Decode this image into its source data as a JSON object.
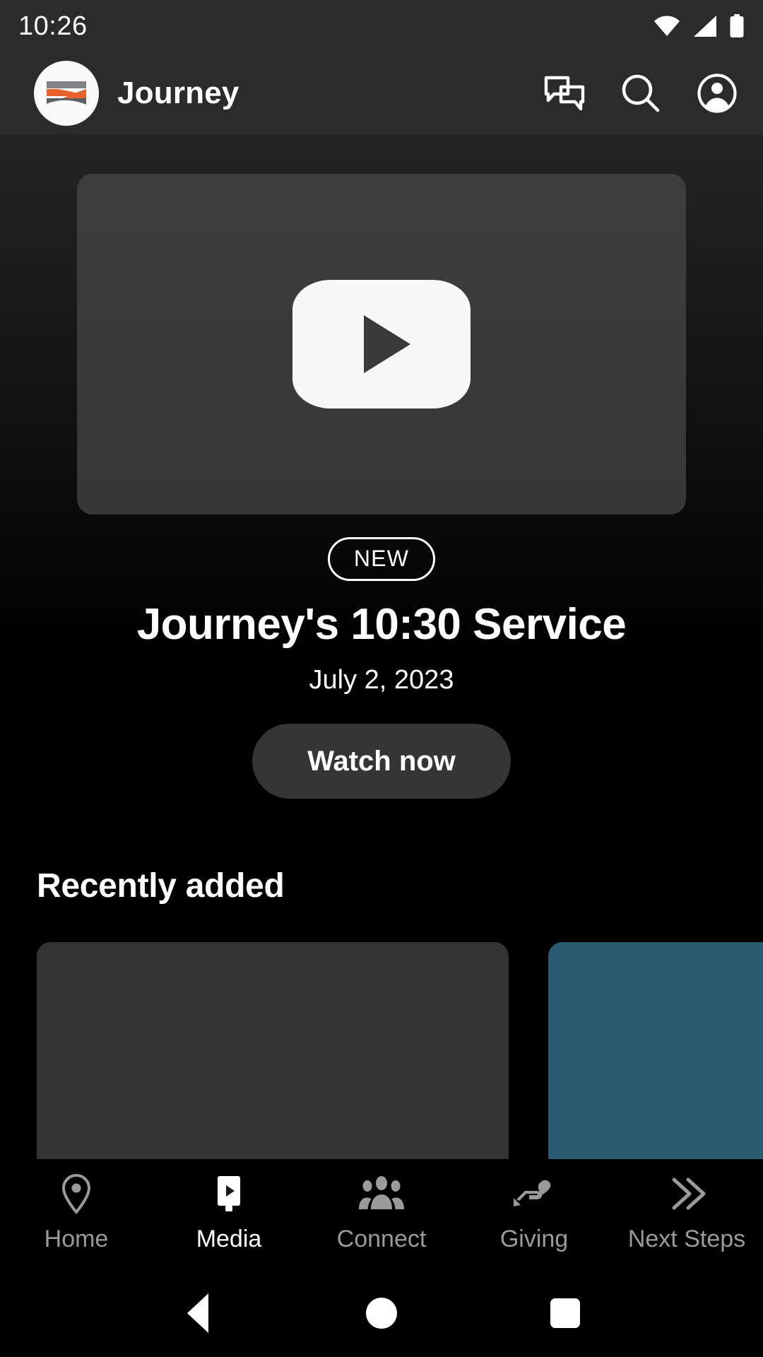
{
  "status_bar": {
    "time": "10:26",
    "icons": [
      "wifi-icon",
      "cellular-signal-icon",
      "battery-icon"
    ]
  },
  "header": {
    "brand_title": "Journey",
    "logo_icon": "journey-logo-icon",
    "actions": [
      {
        "name": "messages-icon",
        "label": "Messages"
      },
      {
        "name": "search-icon",
        "label": "Search"
      },
      {
        "name": "account-circle-icon",
        "label": "Account"
      }
    ]
  },
  "hero": {
    "play_icon": "play-button-icon",
    "badge": "NEW",
    "title": "Journey's 10:30 Service",
    "date": "July 2, 2023",
    "cta_label": "Watch now",
    "thumbnail_color": "#3a3a3a"
  },
  "recently_added": {
    "title": "Recently added",
    "cards": [
      {
        "name": "recently-added-card-1",
        "color": "#333333"
      },
      {
        "name": "recently-added-card-2",
        "color": "#2b5b73"
      }
    ]
  },
  "tab_bar": {
    "active": "Media",
    "items": [
      {
        "label": "Home",
        "icon": "location-pin-icon",
        "active": false
      },
      {
        "label": "Media",
        "icon": "media-play-icon",
        "active": true
      },
      {
        "label": "Connect",
        "icon": "people-group-icon",
        "active": false
      },
      {
        "label": "Giving",
        "icon": "giving-hand-icon",
        "active": false
      },
      {
        "label": "Next Steps",
        "icon": "double-chevron-icon",
        "active": false
      }
    ]
  },
  "android_nav": {
    "back": "back-triangle-icon",
    "home": "home-circle-icon",
    "recents": "recents-square-icon"
  },
  "colors": {
    "background": "#000000",
    "surface": "#2b2b2b",
    "accent_orange": "#e8602c",
    "accent_gray": "#808285",
    "card_teal": "#2b5b73",
    "inactive_text": "#9a9a9a"
  }
}
